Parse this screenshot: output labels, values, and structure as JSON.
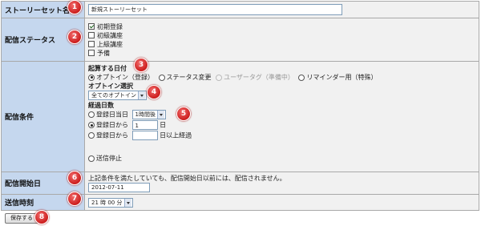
{
  "form": {
    "story_name": {
      "label": "ストーリーセット名",
      "value": "新規ストーリーセット"
    },
    "delivery_status": {
      "label": "配信ステータス",
      "options": [
        {
          "label": "初期登録",
          "checked": true
        },
        {
          "label": "初級講座",
          "checked": false
        },
        {
          "label": "上級講座",
          "checked": false
        },
        {
          "label": "予備",
          "checked": false
        }
      ]
    },
    "delivery_condition": {
      "label": "配信条件",
      "start_heading": "起算する日付",
      "start_options": [
        {
          "label": "オプトイン（登録）",
          "selected": true,
          "disabled": false
        },
        {
          "label": "ステータス変更",
          "selected": false,
          "disabled": false
        },
        {
          "label": "ユーザータグ（準備中）",
          "selected": false,
          "disabled": true
        },
        {
          "label": "リマインダー用（特殊）",
          "selected": false,
          "disabled": false
        }
      ],
      "optin_heading": "オプトイン選択",
      "optin_select": "全てのオプトイン",
      "elapsed_heading": "経過日数",
      "elapsed_option1": "登録日当日",
      "elapsed_select": "1時間後",
      "elapsed_option2": "登録日から",
      "elapsed_days": "1",
      "elapsed_days_unit": "日",
      "elapsed_option3": "登録日から",
      "elapsed_over_value": "",
      "elapsed_over_unit": "日以上経過",
      "stop_label": "送信停止"
    },
    "delivery_start": {
      "label": "配信開始日",
      "note": "上記条件を満たしていても、配信開始日以前には、配信されません。",
      "value": "2012-07-11"
    },
    "send_time": {
      "label": "送信時刻",
      "value": "21 時 00 分"
    },
    "save_label": "保存する"
  },
  "badges": [
    "1",
    "2",
    "3",
    "4",
    "5",
    "6",
    "7",
    "8"
  ],
  "colors": {
    "label_bg": "#c5d7ee",
    "value_bg": "#f1f1f1",
    "badge": "#cc1e1e"
  }
}
